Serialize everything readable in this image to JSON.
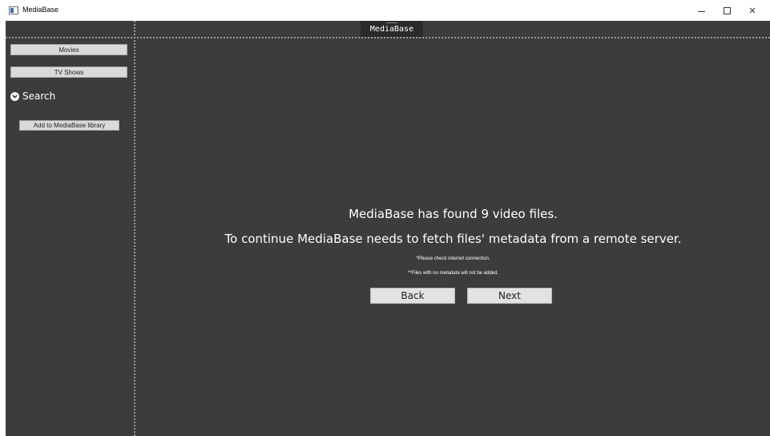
{
  "window": {
    "title": "MediaBase",
    "controls": {
      "minimize": "minimize-icon",
      "maximize": "maximize-icon",
      "close": "close-icon"
    },
    "close_glyph": "✕"
  },
  "header": {
    "brand": "MediaBase"
  },
  "sidebar": {
    "movies_label": "Movies",
    "tv_label": "TV Shows",
    "search_label": "Search",
    "add_label": "Add to MediaBase library"
  },
  "main": {
    "found_message": "MediaBase has found 9 video files.",
    "fetch_message": "To continue MediaBase needs to fetch files' metadata from a remote server.",
    "note_internet": "*Please check internet connection.",
    "note_metadata": "**Files with no metadata will not be added.",
    "back_label": "Back",
    "next_label": "Next"
  },
  "colors": {
    "background": "#3c3c3c",
    "header_tab": "#2a2a2a",
    "button": "#e2e2e2",
    "text": "#ffffff"
  }
}
